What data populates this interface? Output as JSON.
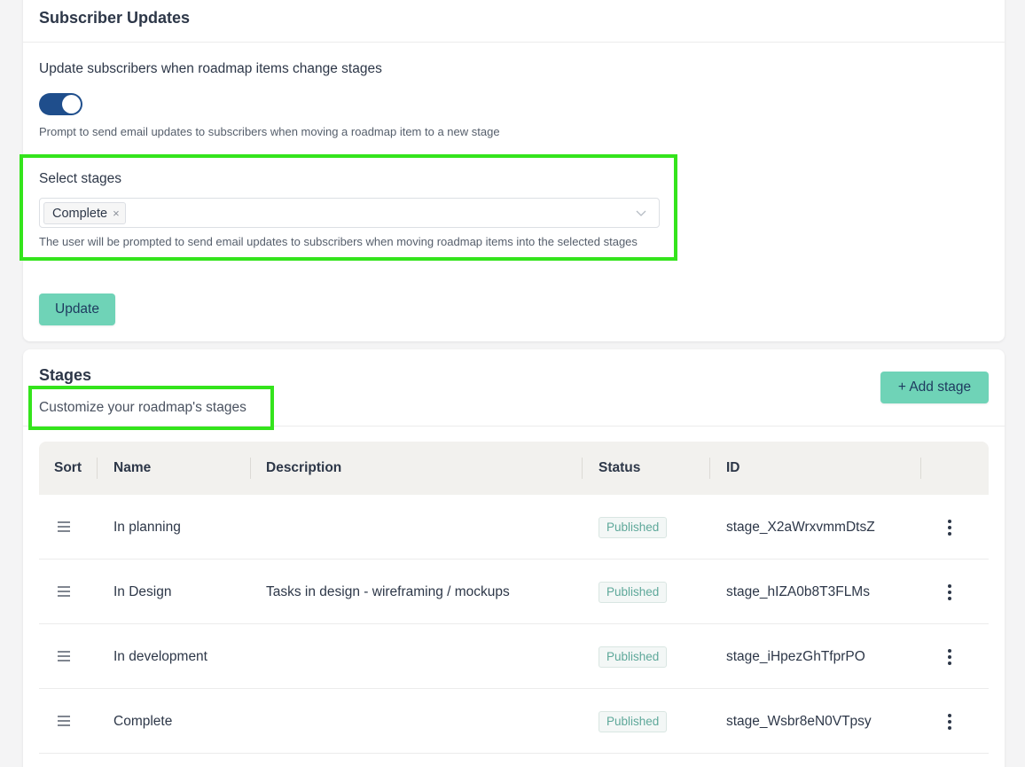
{
  "subscriber": {
    "title": "Subscriber Updates",
    "toggle_label": "Update subscribers when roadmap items change stages",
    "toggle_on": true,
    "toggle_help": "Prompt to send email updates to subscribers when moving a roadmap item to a new stage",
    "select_label": "Select stages",
    "selected_stage": "Complete",
    "remove_tag_glyph": "×",
    "select_help": "The user will be prompted to send email updates to subscribers when moving roadmap items into the selected stages",
    "update_button": "Update"
  },
  "stages": {
    "title": "Stages",
    "subtitle": "Customize your roadmap's stages",
    "add_button": "+ Add stage",
    "columns": {
      "sort": "Sort",
      "name": "Name",
      "description": "Description",
      "status": "Status",
      "id": "ID"
    },
    "rows": [
      {
        "name": "In planning",
        "description": "",
        "status": "Published",
        "id": "stage_X2aWrxvmmDtsZ"
      },
      {
        "name": "In Design",
        "description": "Tasks in design - wireframing / mockups",
        "status": "Published",
        "id": "stage_hIZA0b8T3FLMs"
      },
      {
        "name": "In development",
        "description": "",
        "status": "Published",
        "id": "stage_iHpezGhTfprPO"
      },
      {
        "name": "Complete",
        "description": "",
        "status": "Published",
        "id": "stage_Wsbr8eN0VTpsy"
      }
    ]
  },
  "colors": {
    "accent": "#6fd3b7",
    "toggle": "#1f4e8c",
    "highlight": "#34e41c",
    "badge_text": "#5ea89a"
  },
  "icons": {
    "drag_handle": "hamburger-icon",
    "row_menu": "kebab-icon",
    "select_open": "chevron-down-icon",
    "tag_remove": "close-icon"
  }
}
